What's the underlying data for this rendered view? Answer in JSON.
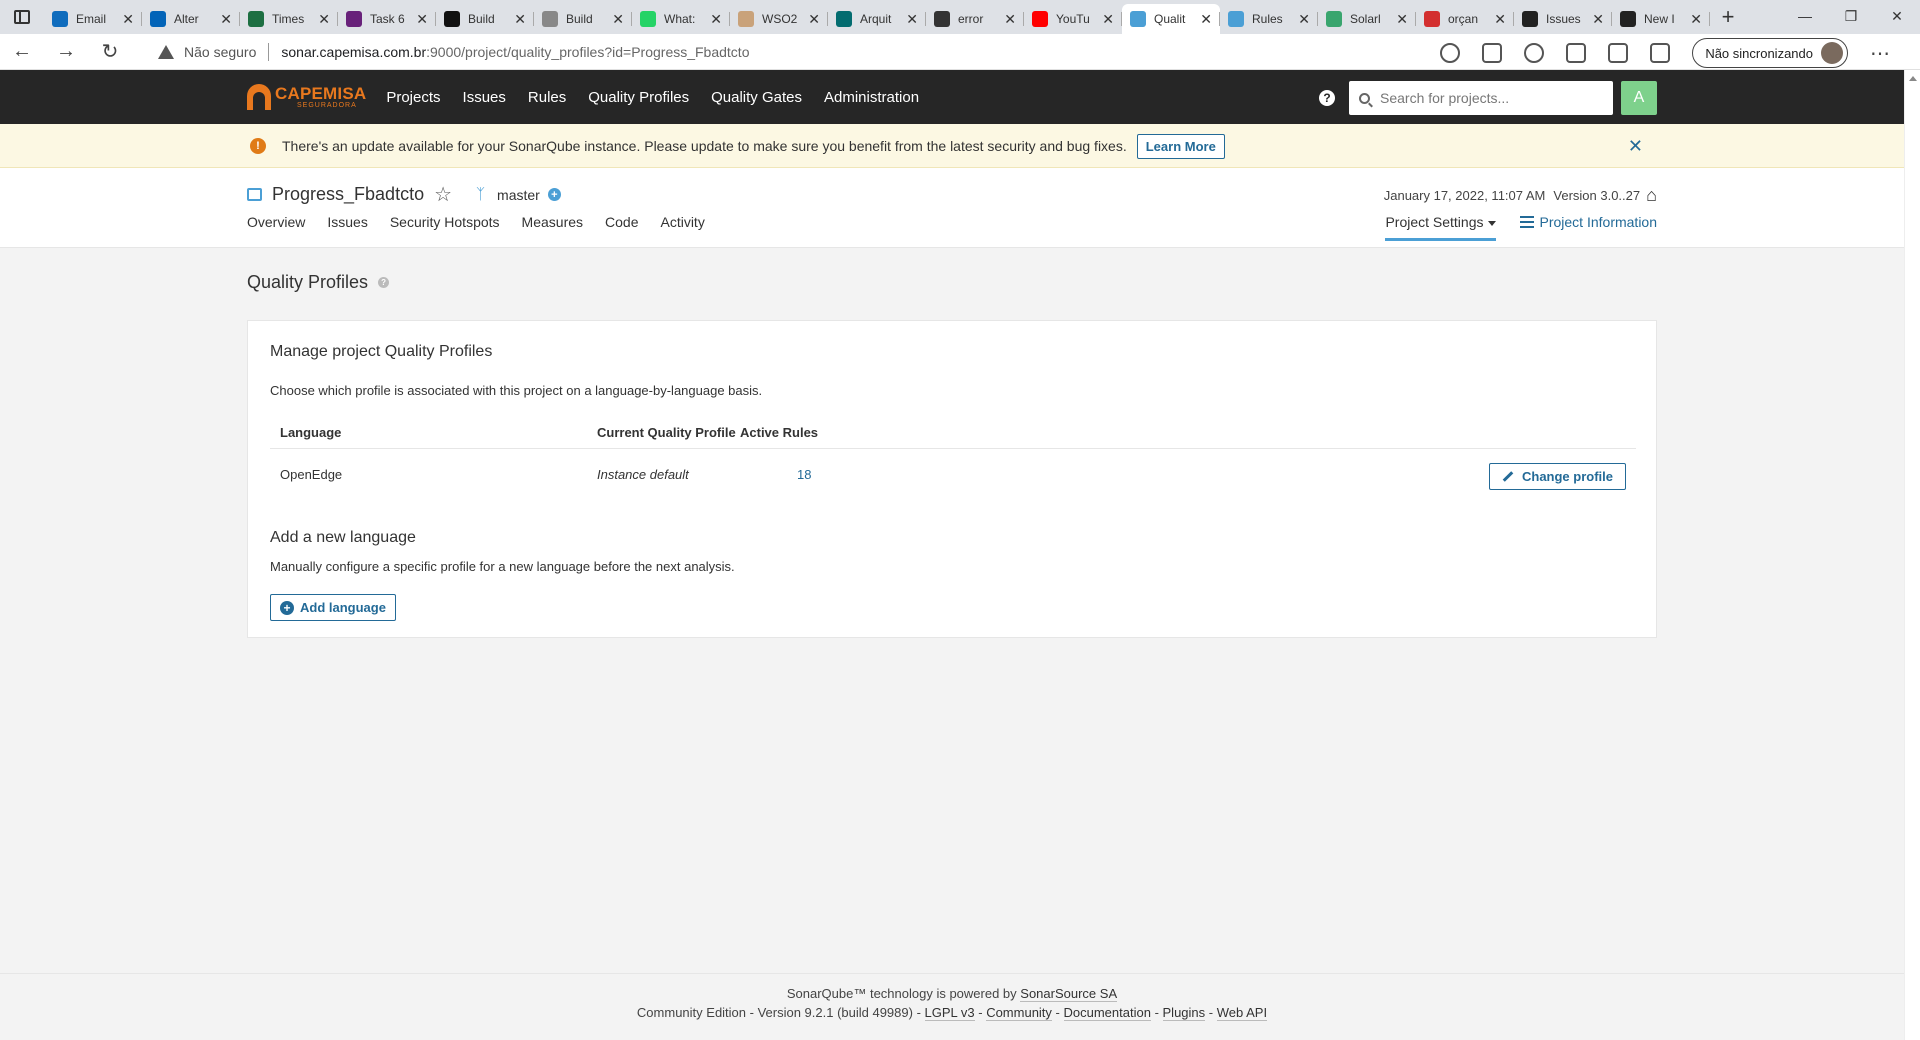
{
  "browser": {
    "tabs": [
      {
        "title": "Email",
        "icon": "outlook-icon",
        "color": "#0f6cbd"
      },
      {
        "title": "Alter",
        "icon": "onedrive-icon",
        "color": "#0364b8"
      },
      {
        "title": "Times",
        "icon": "excel-icon",
        "color": "#1d6f42"
      },
      {
        "title": "Task 6",
        "icon": "visual-studio-icon",
        "color": "#68217a"
      },
      {
        "title": "Build",
        "icon": "teamcity-icon",
        "color": "#111111"
      },
      {
        "title": "Build",
        "icon": "teamcity-icon",
        "color": "#888888"
      },
      {
        "title": "What:",
        "icon": "whatsapp-icon",
        "color": "#25d366"
      },
      {
        "title": "WSO2",
        "icon": "wso2-icon",
        "color": "#c9a27a"
      },
      {
        "title": "Arquit",
        "icon": "sharepoint-icon",
        "color": "#036c70"
      },
      {
        "title": "error",
        "icon": "blog-icon",
        "color": "#333333"
      },
      {
        "title": "YouTu",
        "icon": "youtube-icon",
        "color": "#ff0000"
      },
      {
        "title": "Qualit",
        "icon": "sonarqube-icon",
        "color": "#4b9fd5",
        "active": true
      },
      {
        "title": "Rules",
        "icon": "sonarqube-icon",
        "color": "#4b9fd5"
      },
      {
        "title": "Solarl",
        "icon": "solar-icon",
        "color": "#39a56e"
      },
      {
        "title": "orçan",
        "icon": "pdf-icon",
        "color": "#d32f2f"
      },
      {
        "title": "Issues",
        "icon": "github-icon",
        "color": "#222222"
      },
      {
        "title": "New I",
        "icon": "github-icon",
        "color": "#222222"
      }
    ],
    "insecure_label": "Não seguro",
    "url_host": "sonar.capemisa.com.br",
    "url_rest": ":9000/project/quality_profiles?id=Progress_Fbadtcto",
    "sync_label": "Não sincronizando"
  },
  "nav": {
    "logo_brand": "CAPEMISA",
    "logo_sub": "SEGURADORA",
    "links": [
      "Projects",
      "Issues",
      "Rules",
      "Quality Profiles",
      "Quality Gates",
      "Administration"
    ],
    "search_placeholder": "Search for projects...",
    "avatar_letter": "A"
  },
  "alert": {
    "message": "There's an update available for your SonarQube instance. Please update to make sure you benefit from the latest security and bug fixes.",
    "learn_more": "Learn More"
  },
  "project": {
    "name": "Progress_Fbadtcto",
    "branch": "master",
    "date": "January 17, 2022, 11:07 AM",
    "version": "Version 3.0..27",
    "tabs": [
      "Overview",
      "Issues",
      "Security Hotspots",
      "Measures",
      "Code",
      "Activity"
    ],
    "settings_label": "Project Settings",
    "info_label": "Project Information"
  },
  "page": {
    "title": "Quality Profiles",
    "card_title": "Manage project Quality Profiles",
    "card_desc": "Choose which profile is associated with this project on a language-by-language basis.",
    "table": {
      "headers": [
        "Language",
        "Current Quality Profile",
        "Active Rules"
      ],
      "rows": [
        {
          "language": "OpenEdge",
          "profile": "Instance default",
          "rules": "18"
        }
      ]
    },
    "change_profile": "Change profile",
    "add_title": "Add a new language",
    "add_desc": "Manually configure a specific profile for a new language before the next analysis.",
    "add_button": "Add language"
  },
  "footer": {
    "line1_prefix": "SonarQube™ technology is powered by ",
    "line1_link": "SonarSource SA",
    "edition": "Community Edition - Version 9.2.1 (build 49989) - ",
    "lgpl": "LGPL v3",
    "community": "Community",
    "documentation": "Documentation",
    "plugins": "Plugins",
    "webapi": "Web API",
    "dash": " - "
  }
}
